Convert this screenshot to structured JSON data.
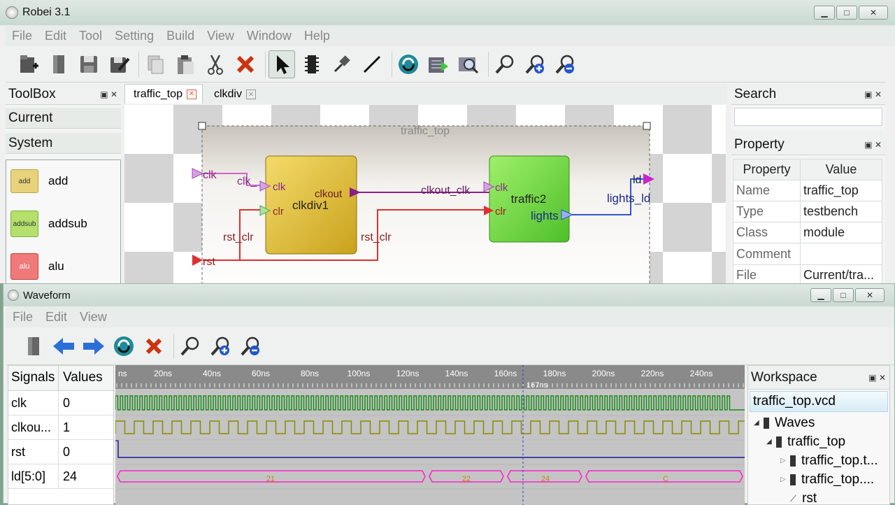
{
  "main_window": {
    "title": "Robei 3.1",
    "menu": [
      "File",
      "Edit",
      "Tool",
      "Setting",
      "Build",
      "View",
      "Window",
      "Help"
    ]
  },
  "toolbox": {
    "title": "ToolBox",
    "sections": [
      "Current",
      "System"
    ],
    "items": [
      {
        "icon_text": "add",
        "label": "add",
        "color": "#e8d27a"
      },
      {
        "icon_text": "addsub",
        "label": "addsub",
        "color": "#b4e06b"
      },
      {
        "icon_text": "alu",
        "label": "alu",
        "color": "#f07a7a"
      }
    ]
  },
  "tabs": [
    {
      "label": "traffic_top",
      "active": true
    },
    {
      "label": "clkdiv",
      "active": false
    }
  ],
  "schematic": {
    "top_name": "traffic_top",
    "ports_left": [
      "clk",
      "rst"
    ],
    "port_right": "ld",
    "block1": {
      "name": "clkdiv1",
      "inputs": [
        "clk",
        "clr"
      ],
      "output": "clkout"
    },
    "block2": {
      "name": "traffic2",
      "inputs": [
        "clk",
        "clr"
      ],
      "output": "lights"
    },
    "wires": {
      "clk_in": "clk_",
      "rst_clr_left": "rst_clr",
      "rst_clr_right": "rst_clr",
      "clkout_clk": "clkout_clk",
      "lights_ld": "lights_ld"
    },
    "colors": {
      "clk": "#cc66cc",
      "rst": "#e03030",
      "clkout": "#8a1f8a",
      "lights": "#3355cc",
      "block1": "#e2bd2c",
      "block2": "#74dd3c"
    }
  },
  "search_panel": {
    "title": "Search"
  },
  "property_panel": {
    "title": "Property",
    "headers": [
      "Property",
      "Value"
    ],
    "rows": [
      {
        "name": "Name",
        "value": "traffic_top"
      },
      {
        "name": "Type",
        "value": "testbench"
      },
      {
        "name": "Class",
        "value": "module"
      },
      {
        "name": "Comment",
        "value": ""
      },
      {
        "name": "File",
        "value": "Current/tra..."
      }
    ]
  },
  "waveform_window": {
    "title": "Waveform",
    "menu": [
      "File",
      "Edit",
      "View"
    ],
    "signals_header": "Signals",
    "values_header": "Values",
    "signals": [
      {
        "name": "clk",
        "value": "0",
        "color": "#1a8a1a"
      },
      {
        "name": "clkou...",
        "value": "1",
        "color": "#8a8a00"
      },
      {
        "name": "rst",
        "value": "0",
        "color": "#1a1a9a"
      },
      {
        "name": "ld[5:0]",
        "value": "24",
        "color": "#ff22cc"
      }
    ],
    "time_labels": [
      "ns",
      "20ns",
      "40ns",
      "60ns",
      "80ns",
      "100ns",
      "120ns",
      "140ns",
      "160ns",
      "180ns",
      "200ns",
      "220ns",
      "240ns"
    ],
    "cursor_label": "167ns",
    "bus_segments": [
      "21",
      "22",
      "24",
      "C"
    ]
  },
  "workspace": {
    "title": "Workspace",
    "file": "traffic_top.vcd",
    "tree": [
      {
        "label": "Waves",
        "level": 0,
        "expander": "◢"
      },
      {
        "label": "traffic_top",
        "level": 1,
        "expander": "◢"
      },
      {
        "label": "traffic_top.t...",
        "level": 2,
        "expander": "▷"
      },
      {
        "label": "traffic_top....",
        "level": 2,
        "expander": "▷"
      },
      {
        "label": "rst",
        "level": 2,
        "expander": ""
      }
    ]
  }
}
